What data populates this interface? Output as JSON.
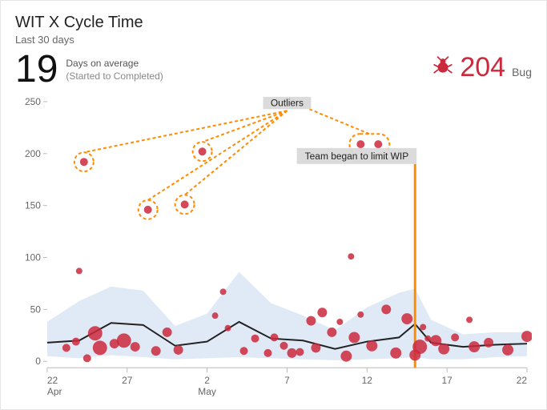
{
  "header": {
    "title": "WIT X Cycle Time",
    "subtitle": "Last 30 days",
    "avg_value": "19",
    "avg_caption": "Days on average",
    "avg_subcaption": "(Started to Completed)",
    "bug_count": "204",
    "bug_label": "Bug"
  },
  "annotations": {
    "outliers_label": "Outliers",
    "vline_label": "Team began to limit WIP"
  },
  "colors": {
    "bug": "#CC293D",
    "accent": "#ff8c00",
    "band": "#dbe8f5",
    "trend": "#222222",
    "axis": "#666666"
  },
  "chart_data": {
    "type": "scatter",
    "title": "WIT X Cycle Time",
    "xlabel": "",
    "ylabel": "",
    "ylim": [
      0,
      250
    ],
    "xlim": [
      0,
      30
    ],
    "y_ticks": [
      0,
      50,
      100,
      150,
      200,
      250
    ],
    "x_ticks": [
      {
        "pos": 0,
        "line1": "22",
        "line2": "Apr"
      },
      {
        "pos": 5,
        "line1": "27",
        "line2": ""
      },
      {
        "pos": 10,
        "line1": "2",
        "line2": "May"
      },
      {
        "pos": 15,
        "line1": "7",
        "line2": ""
      },
      {
        "pos": 20,
        "line1": "12",
        "line2": ""
      },
      {
        "pos": 25,
        "line1": "17",
        "line2": ""
      },
      {
        "pos": 30,
        "line1": "22",
        "line2": ""
      }
    ],
    "vline_x": 23,
    "points": [
      {
        "x": 1.2,
        "y": 13,
        "r": 5
      },
      {
        "x": 1.8,
        "y": 19,
        "r": 5
      },
      {
        "x": 2.0,
        "y": 87,
        "r": 4
      },
      {
        "x": 2.3,
        "y": 192,
        "r": 5,
        "outlier": true,
        "ring": "c"
      },
      {
        "x": 2.5,
        "y": 3,
        "r": 5
      },
      {
        "x": 3.0,
        "y": 27,
        "r": 9
      },
      {
        "x": 3.3,
        "y": 13,
        "r": 9
      },
      {
        "x": 4.2,
        "y": 17,
        "r": 6
      },
      {
        "x": 4.8,
        "y": 20,
        "r": 9
      },
      {
        "x": 5.5,
        "y": 14,
        "r": 6
      },
      {
        "x": 6.3,
        "y": 146,
        "r": 5,
        "outlier": true,
        "ring": "c"
      },
      {
        "x": 6.8,
        "y": 10,
        "r": 6
      },
      {
        "x": 7.5,
        "y": 28,
        "r": 6
      },
      {
        "x": 8.2,
        "y": 11,
        "r": 6
      },
      {
        "x": 8.6,
        "y": 151,
        "r": 5,
        "outlier": true,
        "ring": "c"
      },
      {
        "x": 9.7,
        "y": 202,
        "r": 5,
        "outlier": true,
        "ring": "c"
      },
      {
        "x": 10.5,
        "y": 44,
        "r": 4
      },
      {
        "x": 11.0,
        "y": 67,
        "r": 4
      },
      {
        "x": 11.3,
        "y": 32,
        "r": 4
      },
      {
        "x": 12.3,
        "y": 10,
        "r": 5
      },
      {
        "x": 13.0,
        "y": 22,
        "r": 5
      },
      {
        "x": 13.8,
        "y": 8,
        "r": 5
      },
      {
        "x": 14.2,
        "y": 23,
        "r": 5
      },
      {
        "x": 14.8,
        "y": 15,
        "r": 5
      },
      {
        "x": 15.3,
        "y": 8,
        "r": 6
      },
      {
        "x": 15.8,
        "y": 9,
        "r": 5
      },
      {
        "x": 16.5,
        "y": 39,
        "r": 6
      },
      {
        "x": 16.8,
        "y": 13,
        "r": 6
      },
      {
        "x": 17.2,
        "y": 47,
        "r": 6
      },
      {
        "x": 17.8,
        "y": 28,
        "r": 6
      },
      {
        "x": 18.3,
        "y": 38,
        "r": 4
      },
      {
        "x": 18.7,
        "y": 5,
        "r": 7
      },
      {
        "x": 19.0,
        "y": 101,
        "r": 4
      },
      {
        "x": 19.2,
        "y": 23,
        "r": 7
      },
      {
        "x": 19.6,
        "y": 45,
        "r": 4
      },
      {
        "x": 19.6,
        "y": 209,
        "r": 5,
        "outlier": true,
        "ring": "g"
      },
      {
        "x": 20.3,
        "y": 15,
        "r": 7
      },
      {
        "x": 20.7,
        "y": 209,
        "r": 5,
        "outlier": true,
        "ring": "g"
      },
      {
        "x": 21.2,
        "y": 50,
        "r": 6
      },
      {
        "x": 21.8,
        "y": 8,
        "r": 7
      },
      {
        "x": 22.5,
        "y": 41,
        "r": 7
      },
      {
        "x": 23.0,
        "y": 6,
        "r": 7
      },
      {
        "x": 23.3,
        "y": 14,
        "r": 9
      },
      {
        "x": 23.5,
        "y": 33,
        "r": 4
      },
      {
        "x": 23.8,
        "y": 22,
        "r": 4
      },
      {
        "x": 24.3,
        "y": 20,
        "r": 7
      },
      {
        "x": 24.8,
        "y": 12,
        "r": 7
      },
      {
        "x": 25.5,
        "y": 23,
        "r": 5
      },
      {
        "x": 26.4,
        "y": 40,
        "r": 4
      },
      {
        "x": 26.7,
        "y": 14,
        "r": 7
      },
      {
        "x": 27.6,
        "y": 18,
        "r": 6
      },
      {
        "x": 28.8,
        "y": 11,
        "r": 7
      },
      {
        "x": 30.0,
        "y": 24,
        "r": 7
      }
    ],
    "trend": [
      {
        "x": 0,
        "y": 18
      },
      {
        "x": 2,
        "y": 20
      },
      {
        "x": 4,
        "y": 37
      },
      {
        "x": 6,
        "y": 35
      },
      {
        "x": 8,
        "y": 15
      },
      {
        "x": 10,
        "y": 19
      },
      {
        "x": 12,
        "y": 38
      },
      {
        "x": 14,
        "y": 22
      },
      {
        "x": 16,
        "y": 20
      },
      {
        "x": 18,
        "y": 12
      },
      {
        "x": 20,
        "y": 19
      },
      {
        "x": 22,
        "y": 23
      },
      {
        "x": 23,
        "y": 36
      },
      {
        "x": 24,
        "y": 18
      },
      {
        "x": 26,
        "y": 14
      },
      {
        "x": 28,
        "y": 16
      },
      {
        "x": 30,
        "y": 17
      }
    ],
    "band_upper": [
      {
        "x": 0,
        "y": 38
      },
      {
        "x": 2,
        "y": 58
      },
      {
        "x": 4,
        "y": 72
      },
      {
        "x": 6,
        "y": 68
      },
      {
        "x": 8,
        "y": 34
      },
      {
        "x": 10,
        "y": 46
      },
      {
        "x": 12,
        "y": 86
      },
      {
        "x": 14,
        "y": 56
      },
      {
        "x": 16,
        "y": 44
      },
      {
        "x": 18,
        "y": 30
      },
      {
        "x": 20,
        "y": 52
      },
      {
        "x": 22,
        "y": 66
      },
      {
        "x": 23,
        "y": 70
      },
      {
        "x": 24,
        "y": 40
      },
      {
        "x": 26,
        "y": 26
      },
      {
        "x": 28,
        "y": 28
      },
      {
        "x": 30,
        "y": 28
      }
    ],
    "band_lower": [
      {
        "x": 0,
        "y": 5
      },
      {
        "x": 2,
        "y": 3
      },
      {
        "x": 4,
        "y": 6
      },
      {
        "x": 6,
        "y": 4
      },
      {
        "x": 8,
        "y": 2
      },
      {
        "x": 10,
        "y": 3
      },
      {
        "x": 12,
        "y": 4
      },
      {
        "x": 14,
        "y": 3
      },
      {
        "x": 16,
        "y": 2
      },
      {
        "x": 18,
        "y": 1
      },
      {
        "x": 20,
        "y": 2
      },
      {
        "x": 22,
        "y": 3
      },
      {
        "x": 23,
        "y": 4
      },
      {
        "x": 24,
        "y": 2
      },
      {
        "x": 26,
        "y": 2
      },
      {
        "x": 28,
        "y": 4
      },
      {
        "x": 30,
        "y": 5
      }
    ]
  }
}
